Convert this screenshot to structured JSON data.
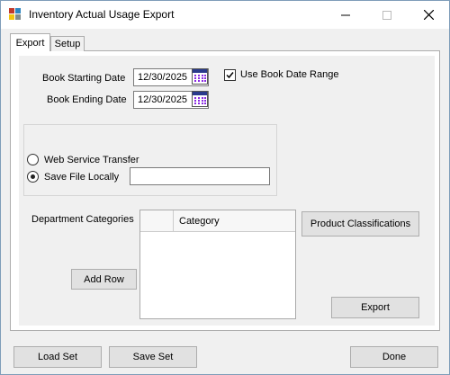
{
  "window": {
    "title": "Inventory Actual Usage Export",
    "icon": "inventory-app-icon",
    "controls": {
      "minimize": "minimize-icon",
      "maximize": "maximize-icon",
      "close": "close-icon"
    }
  },
  "tabs": [
    {
      "label": "Export",
      "selected": true
    },
    {
      "label": "Setup",
      "selected": false
    }
  ],
  "dates": {
    "starting_label": "Book Starting Date",
    "starting_value": "12/30/2025",
    "ending_label": "Book Ending Date",
    "ending_value": "12/30/2025",
    "calendar_icon": "calendar-icon"
  },
  "use_book_date_range": {
    "label": "Use Book Date Range",
    "checked": true
  },
  "transfer": {
    "web_service_label": "Web Service Transfer",
    "web_service_selected": false,
    "save_locally_label": "Save File Locally",
    "save_locally_selected": true,
    "file_path": ""
  },
  "departments": {
    "label": "Department Categories",
    "column_header": "Category",
    "rows": []
  },
  "buttons": {
    "add_row": "Add Row",
    "product_classifications": "Product Classifications",
    "export": "Export",
    "load_set": "Load Set",
    "save_set": "Save Set",
    "done": "Done"
  }
}
